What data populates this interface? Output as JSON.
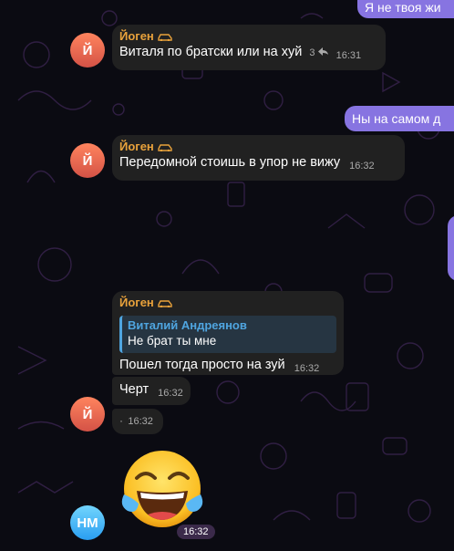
{
  "chat": {
    "outgoing_top": "Я не твоя жи",
    "outgoing_mid": "Ны на самом д",
    "messages": [
      {
        "sender": "Йоген",
        "text": "Виталя по братски или на хуй",
        "replies": "3",
        "time": "16:31"
      },
      {
        "sender": "Йоген",
        "text": "Передомной стоишь в упор не вижу",
        "time": "16:32"
      },
      {
        "sender": "Йоген",
        "reply_name": "Виталий Андреянов",
        "reply_text": "Не брат ты мне",
        "text": "Пошел тогда просто на зуй",
        "time": "16:32"
      },
      {
        "text": "Черт",
        "time": "16:32"
      },
      {
        "text": "·",
        "time": "16:32"
      }
    ],
    "avatar_y": "Й",
    "avatar_nm": "НМ",
    "sticker_time": "16:32"
  },
  "colors": {
    "background": "#0b0b12",
    "incoming_bubble": "#212121",
    "outgoing_bubble": "#8774e1",
    "sender_name": "#e9a23b",
    "reply_accent": "#4fa5e0"
  },
  "icons": {
    "sender_badge": "car-icon",
    "reply_count": "reply-arrow-icon",
    "sticker": "tears-of-joy-emoji"
  }
}
